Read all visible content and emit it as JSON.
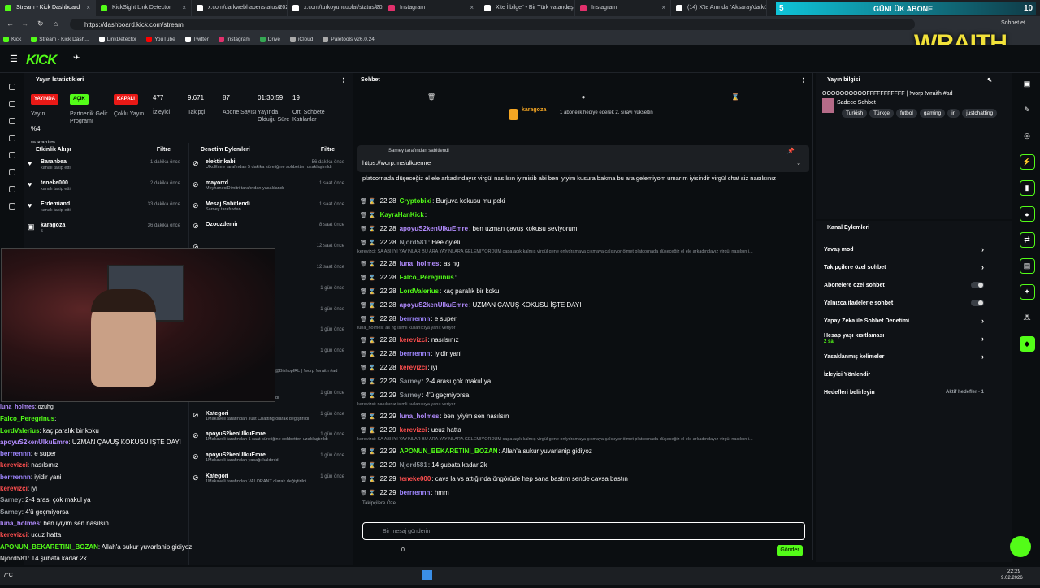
{
  "browser": {
    "tabs": [
      "Stream - Kick Dashboard",
      "KickSight Link Detector",
      "x.com/darkwebhaber/status/2020...",
      "x.com/turkoyuncuplat/status/202...",
      "Instagram",
      "X'te İlbilge\" • Bir Türk vatandaşı...",
      "Instagram",
      "(14) X'te Anında \"Aksaray'da küç..."
    ],
    "url": "https://dashboard.kick.com/stream",
    "bookmarks": [
      "Kick",
      "Stream - Kick Dash...",
      "LinkDetector",
      "YouTube",
      "Twitter",
      "Instagram",
      "Drive",
      "iCloud",
      "Paletools v26.0.24"
    ],
    "right_text": "Sohbet et"
  },
  "overlay": {
    "sub_label": "GÜNLÜK ABONE",
    "sub_count": "10",
    "wraith": "WRAITH",
    "sub_num": "5"
  },
  "brand": {
    "logo": "KICK",
    "accent": "#53fc18"
  },
  "stats": {
    "title": "Yayın İstatistikleri",
    "badges": [
      "YAYINDA",
      "AÇIK",
      "KAPALI"
    ],
    "labels": [
      "Yayın",
      "Partnerlik Gelir Programı",
      "Çoklu Yayın",
      "İzleyici",
      "Takipçi",
      "Abone Sayısı",
      "Yayında Olduğu Süre",
      "Ort. Sohbete Katılanlar",
      "% Katılım"
    ],
    "values": [
      "477",
      "9.671",
      "87",
      "01:30:59",
      "19",
      "%4"
    ]
  },
  "activity": {
    "title": "Etkinlik Akışı",
    "filter": "Filtre",
    "items": [
      {
        "n": "Baranbea",
        "s": "kanalı takip etti",
        "t": "1 dakika önce"
      },
      {
        "n": "teneke000",
        "s": "kanalı takip etti",
        "t": "2 dakika önce"
      },
      {
        "n": "Erdemiand",
        "s": "kanalı takip etti",
        "t": "33 dakika önce"
      },
      {
        "n": "karagoza",
        "s": "5",
        "t": "36 dakika önce"
      }
    ]
  },
  "mod": {
    "title": "Denetim Eylemleri",
    "filter": "Filtre",
    "items": [
      {
        "n": "elektirikabi",
        "s": "UlkuEmre tarafından 5 dakika süreliğine sohbetten uzaklaştırıldı",
        "t": "56 dakika önce"
      },
      {
        "n": "mayorrd",
        "s": "MeyhaneciDimitri tarafından yasaklandı",
        "t": "1 saat önce"
      },
      {
        "n": "Mesaj Sabitlendi",
        "s": "Sarney tarafından",
        "t": "1 saat önce"
      },
      {
        "n": "Ozoozdemir",
        "s": "",
        "t": "8 saat önce"
      },
      {
        "n": "",
        "s": "",
        "t": "12 saat önce"
      },
      {
        "n": "",
        "s": "",
        "t": "12 saat önce"
      },
      {
        "n": "",
        "s": "",
        "t": "1 gün önce"
      },
      {
        "n": "",
        "s": "",
        "t": "1 gün önce"
      },
      {
        "n": "",
        "s": "| !worp !wraith #ad olarak",
        "t": "1 gün önce"
      },
      {
        "n": "",
        "s": "",
        "t": "1 gün önce"
      },
      {
        "n": "",
        "s": "UlkuEmre tarafından ülkü kim a w/ @BishopIRL | !worp !wraith #ad olarak değiştirildi",
        "t": ""
      },
      {
        "n": "vergimen",
        "s": "UlkuEmre tarafından yasağı kaldırıldı",
        "t": "1 gün önce"
      },
      {
        "n": "Kategori",
        "s": "1Makaveli tarafından Just Chatting olarak değiştirildi",
        "t": "1 gün önce"
      },
      {
        "n": "apoyuS2kenUlkuEmre",
        "s": "1Makaveli tarafından 1 saat süreliğine sohbetten uzaklaştırıldı",
        "t": "1 gün önce"
      },
      {
        "n": "apoyuS2kenUlkuEmre",
        "s": "1Makaveli tarafından yasağı kaldırıldı",
        "t": "1 gün önce"
      },
      {
        "n": "Kategori",
        "s": "1Makaveli tarafından VALORANT olarak değiştirildi",
        "t": "1 gün önce"
      }
    ]
  },
  "chat": {
    "title": "Sohbet",
    "gift_user": "karagoza",
    "gift_text": "1 abonelik hediye ederek 2. sırayı yükseltin",
    "pinned_by": "Sarney tarafından sabitlendi",
    "pinned_link": "https://worp.me/ulkuemre",
    "first_line": "ERDEMİAND: Hee",
    "long_msg": "platcornada düşeceğiz el ele arkadındayız virgül nasılsın iyimisib abi ben iyiyim kusura bakma bu ara gelemiyom umarım iyisindir virgül chat siz nasılsınız",
    "messages": [
      {
        "t": "22:28",
        "u": "Cryptobixi",
        "c": "#53fc18",
        "m": ": Burjuva kokusu mu peki"
      },
      {
        "t": "",
        "u": "KayraHanKick",
        "c": "#53fc18",
        "m": ":"
      },
      {
        "t": "22:28",
        "u": "apoyuS2kenUlkuEmre",
        "c": "#b38cff",
        "m": ": ben uzman çavuş kokusu seviyorum"
      },
      {
        "t": "22:28",
        "u": "Njord581",
        "c": "#8b9096",
        "m": ": Hee öyleli"
      },
      {
        "sys": "kerevizci: SA ABİ İYİ YAYINLAR BU ARA YAYINLARA GELEMİYORDUM capa açık kalmış virgül gene onlydramaya çıkmaya çalışıyor ölmet platcornada düşeceğiz el ele arkadındayız virgül nasılsın i..."
      },
      {
        "t": "22:28",
        "u": "luna_holmes",
        "c": "#b38cff",
        "m": ": as hg"
      },
      {
        "t": "22:28",
        "u": "Falco_Peregrinus",
        "c": "#53fc18",
        "m": ":"
      },
      {
        "t": "22:28",
        "u": "LordValerius",
        "c": "#53fc18",
        "m": ": kaç paralık bir koku"
      },
      {
        "t": "22:28",
        "u": "apoyuS2kenUlkuEmre",
        "c": "#b38cff",
        "m": ": UZMAN ÇAVUŞ KOKUSU İŞTE DAYI"
      },
      {
        "t": "22:28",
        "u": "berrrennn",
        "c": "#9f86ff",
        "m": ": e super"
      },
      {
        "sys": "luna_holmes: as hg isimli kullanıcıya yanıt veriyor"
      },
      {
        "t": "22:28",
        "u": "kerevizci",
        "c": "#ff4f4f",
        "m": ": nasılsınız"
      },
      {
        "t": "22:28",
        "u": "berrrennn",
        "c": "#9f86ff",
        "m": ": iyidir yani"
      },
      {
        "t": "22:28",
        "u": "kerevizci",
        "c": "#ff4f4f",
        "m": ": iyi"
      },
      {
        "t": "22:29",
        "u": "Sarney",
        "c": "#8b9096",
        "m": ": 2-4 arası çok makul ya"
      },
      {
        "t": "22:29",
        "u": "Sarney",
        "c": "#8b9096",
        "m": ": 4'ü geçmiyorsa"
      },
      {
        "sys": "kerevizci: nasılsınız isimli kullanıcıya yanıt veriyor"
      },
      {
        "t": "22:29",
        "u": "luna_holmes",
        "c": "#b38cff",
        "m": ": ben iyiyim sen nasılsın"
      },
      {
        "t": "22:29",
        "u": "kerevizci",
        "c": "#ff4f4f",
        "m": ": ucuz hatta"
      },
      {
        "sys": "kerevizci: SA ABİ İYİ YAYINLAR BU ARA YAYINLARA GELEMİYORDUM capa açık kalmış virgül gene onlydramaya çıkmaya çalışıyor ölmet platcornada düşeceğiz el ele arkadındayız virgül nasılsın i..."
      },
      {
        "t": "22:29",
        "u": "APONUN_BEKARETINI_BOZAN",
        "c": "#53fc18",
        "m": ": Allah'a sukur yuvarlanip gidiyoz"
      },
      {
        "t": "22:29",
        "u": "Njord581",
        "c": "#8b9096",
        "m": ": 14 şubata kadar 2k"
      },
      {
        "t": "22:29",
        "u": "teneke000",
        "c": "#ff4f4f",
        "m": ": cavs la vs attığında öngörüde hep sana bastım sende cavsa bastın"
      },
      {
        "t": "22:29",
        "u": "berrrennn",
        "c": "#9f86ff",
        "m": ": hmm"
      }
    ],
    "followers_label": "Takipçilere Özel",
    "placeholder": "Bir mesaj gönderin",
    "send": "Gönder",
    "count": "0"
  },
  "info": {
    "title": "Yayın bilgisi",
    "stream_title": "OOOOOOOOOOFFFFFFFFFFF | !worp !wraith #ad",
    "category": "Sadece Sohbet",
    "tags": [
      "Turkish",
      "Türkçe",
      "futbol",
      "gaming",
      "irl",
      "justchatting"
    ]
  },
  "channel": {
    "title": "Kanal Eylemleri",
    "rows": [
      "Yavaş mod",
      "Takipçilere özel sohbet",
      "Abonelere özel sohbet",
      "Yalnızca ifadelerle sohbet",
      "Yapay Zeka ile Sohbet Denetimi",
      "Hesap yaşı kısıtlaması",
      "Yasaklanmış kelimeler",
      "İzleyici Yönlendir",
      "Hedefleri belirleyin"
    ],
    "age_sub": "2 sa.",
    "goal_sub": "Aktif hedefler - 1"
  },
  "overlay_chat": [
    {
      "u": "luna_holmes",
      "m": ": ozuhg"
    },
    {
      "u": "Falco_Peregrinus",
      "m": ":"
    },
    {
      "u": "LordValerius",
      "m": ": kaç paralık bir koku"
    },
    {
      "u": "apoyuS2kenUlkuEmre",
      "m": ": UZMAN ÇAVUŞ KOKUSU İŞTE DAYI"
    },
    {
      "u": "berrrennn",
      "m": ": e super"
    },
    {
      "u": "kerevizci",
      "m": ": nasılsınız"
    },
    {
      "u": "berrrennn",
      "m": ": iyidir yani"
    },
    {
      "u": "kerevizci",
      "m": ": iyi"
    },
    {
      "u": "Sarney",
      "m": ": 2-4 arası çok makul ya"
    },
    {
      "u": "Sarney",
      "m": ": 4'ü geçmiyorsa"
    },
    {
      "u": "luna_holmes",
      "m": ": ben iyiyim sen nasılsın"
    },
    {
      "u": "kerevizci",
      "m": ": ucuz hatta"
    },
    {
      "u": "APONUN_BEKARETINI_BOZAN",
      "m": ": Allah'a sukur yuvarlanip gidiyoz"
    },
    {
      "u": "Njord581",
      "m": ": 14 şubata kadar 2k"
    },
    {
      "u": "teneke000",
      "m": ": cavs la vs attığında öngörüde hep sana bastım sende cavsa bastın"
    },
    {
      "u": "berrrennn",
      "m": ": hmm"
    }
  ],
  "system_tray": {
    "time": "22:29",
    "date": "9.02.2026",
    "temp": "7°C"
  }
}
